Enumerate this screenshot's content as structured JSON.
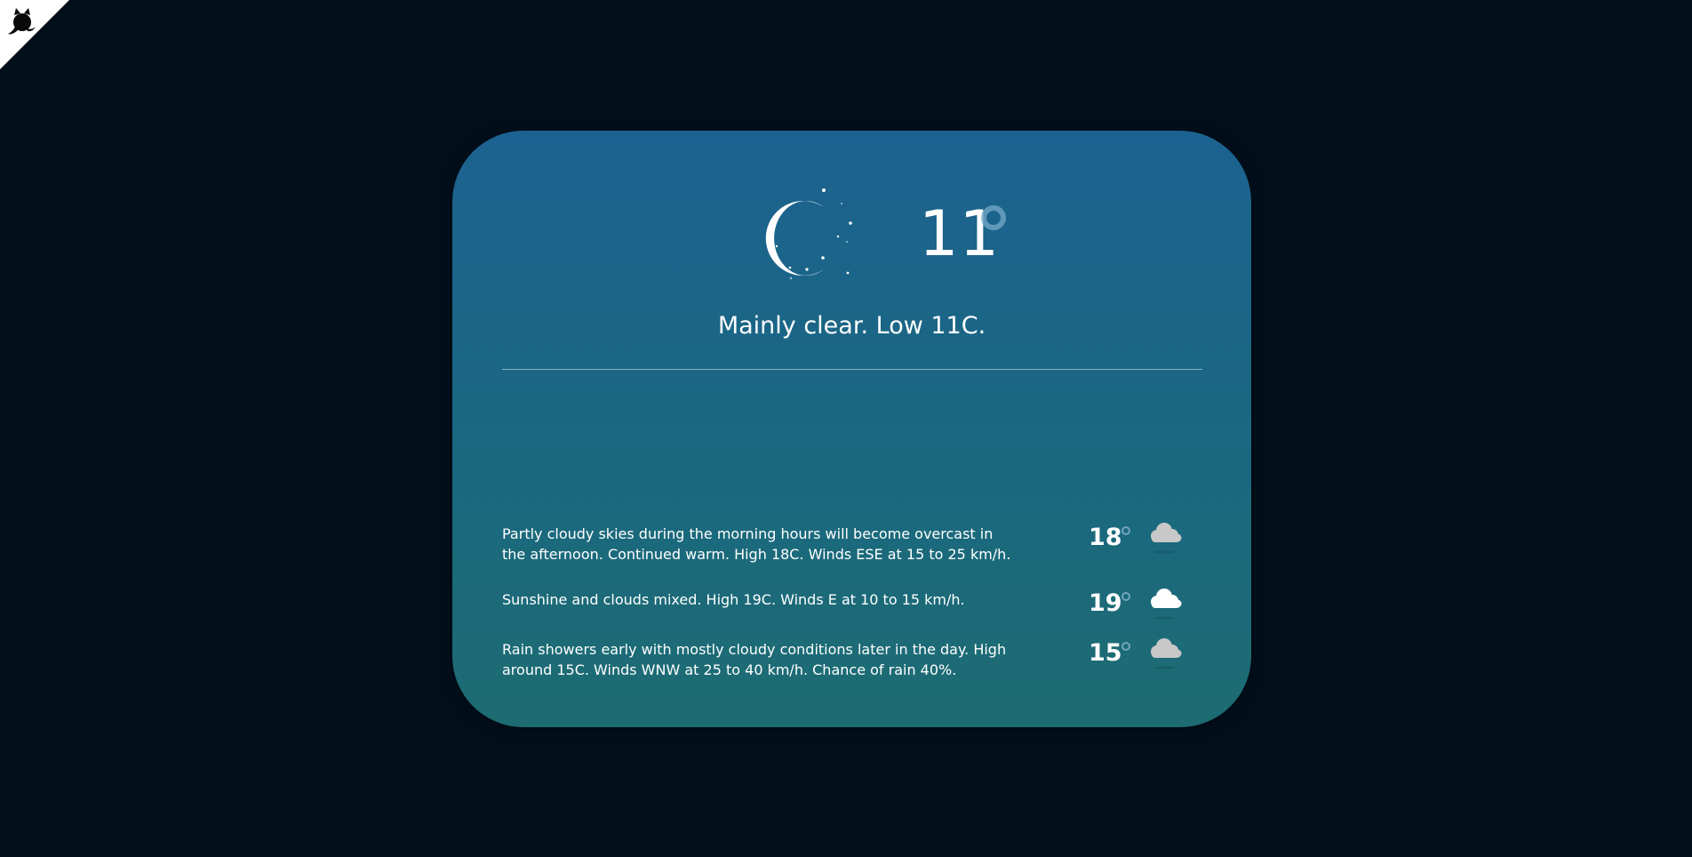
{
  "corner_badge": {
    "icon": "octocat-icon"
  },
  "current": {
    "icon": "moon-stars-icon",
    "temperature": "11",
    "summary": "Mainly clear. Low 11C."
  },
  "forecast": [
    {
      "text": "Partly cloudy skies during the morning hours will become overcast in the afternoon. Continued warm. High 18C. Winds ESE at 15 to 25 km/h.",
      "temperature": "18",
      "icon": "cloud-icon"
    },
    {
      "text": "Sunshine and clouds mixed. High 19C. Winds E at 10 to 15 km/h.",
      "temperature": "19",
      "icon": "cloud-icon"
    },
    {
      "text": "Rain showers early with mostly cloudy conditions later in the day. High around 15C. Winds WNW at 25 to 40 km/h. Chance of rain 40%.",
      "temperature": "15",
      "icon": "cloud-icon"
    }
  ],
  "colors": {
    "background": "#020f1b",
    "card_top": "#1c6290",
    "card_bottom": "#1d6c72",
    "text": "#ffffff"
  }
}
